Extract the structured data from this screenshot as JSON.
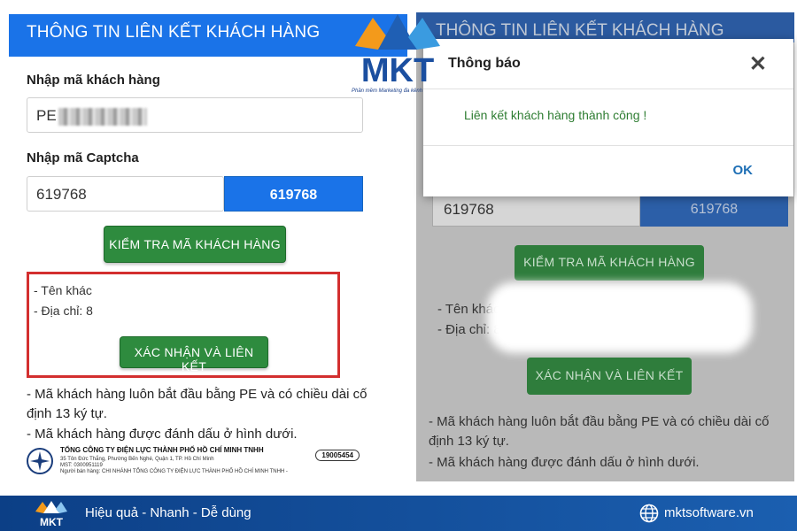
{
  "left_form": {
    "header": "THÔNG TIN LIÊN KẾT KHÁCH HÀNG",
    "customer_code_label": "Nhập mã khách hàng",
    "customer_code_value": "PE",
    "captcha_label": "Nhập mã Captcha",
    "captcha_input_value": "619768",
    "captcha_image_text": "619768",
    "check_button": "KIỂM TRA MÃ KHÁCH HÀNG",
    "result_name": "- Tên khác",
    "result_address": "- Địa chỉ: 8",
    "confirm_button": "XÁC NHẬN VÀ LIÊN KẾT",
    "note_1": "- Mã khách hàng luôn bắt đầu bằng PE và có chiều dài cố định 13 ký tự.",
    "note_2": "- Mã khách hàng được đánh dấu ở hình dưới.",
    "bill_company": "TỔNG CÔNG TY ĐIỆN LỰC THÀNH PHỐ HỒ CHÍ MINH TNHH",
    "bill_address": "35 Tôn Đức Thắng, Phường Bến Nghé, Quận 1, TP. Hồ Chí Minh",
    "bill_tax": "MST: 0300951119",
    "bill_branch": "Người bán hàng: CHI NHÁNH TỔNG CÔNG TY ĐIỆN LỰC THÀNH PHỐ HỒ CHÍ MINH TNHH -",
    "bill_phone": "19005454"
  },
  "right_form": {
    "header": "THÔNG TIN LIÊN KẾT KHÁCH HÀNG",
    "captcha_input_value": "619768",
    "captcha_image_text": "619768",
    "check_button": "KIỂM TRA MÃ KHÁCH HÀNG",
    "result_name": "- Tên khác",
    "result_address": "- Địa chỉ: 8",
    "confirm_button": "XÁC NHẬN VÀ LIÊN KẾT",
    "note_1": "- Mã khách hàng luôn bắt đầu bằng PE và có chiều dài cố định 13 ký tự.",
    "note_2": "- Mã khách hàng được đánh dấu ở hình dưới."
  },
  "dialog": {
    "title": "Thông báo",
    "close_icon": "close-icon",
    "message": "Liên kết khách hàng thành công !",
    "ok_button": "OK"
  },
  "brand": {
    "logo_text": "MKT",
    "logo_tagline": "Phần mềm Marketing đa kênh",
    "slogan": "Hiệu quả - Nhanh - Dễ dùng",
    "website": "mktsoftware.vn",
    "colors": {
      "primary_blue": "#1a73e8",
      "button_green": "#2e8b3e",
      "highlight_red": "#d32f2f",
      "success_text": "#2e7d32",
      "bar_blue": "#0c3f86"
    }
  }
}
